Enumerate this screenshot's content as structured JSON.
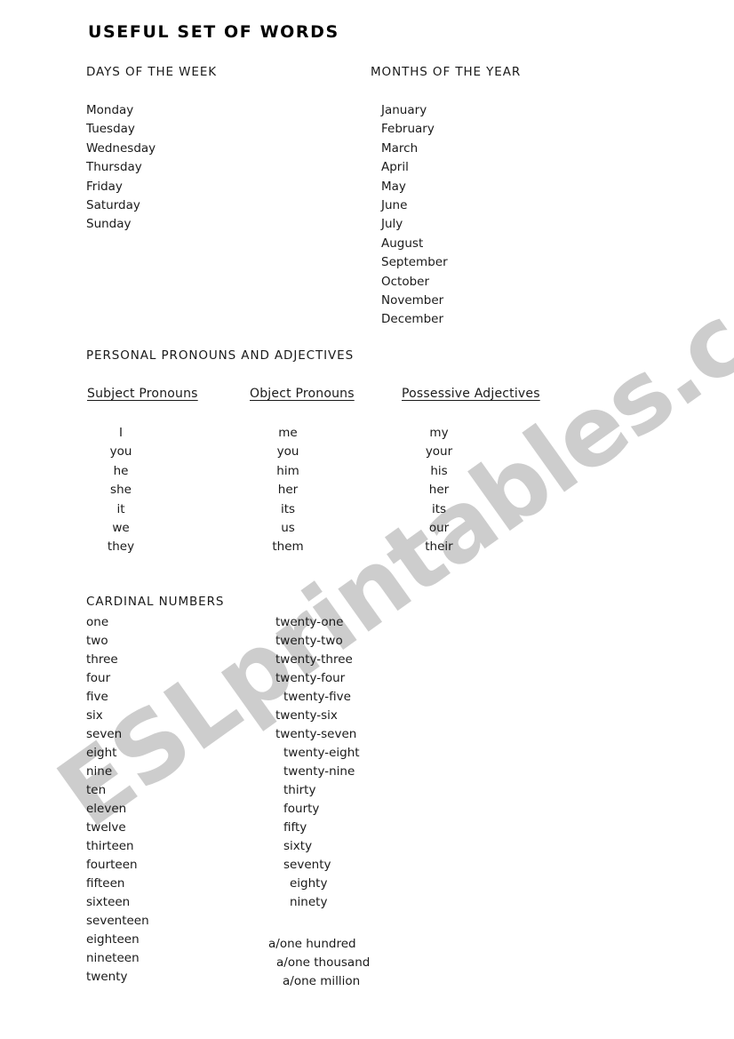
{
  "document": {
    "title": "USEFUL SET OF WORDS"
  },
  "watermark": {
    "text": "ESLprintables.com",
    "color": "#cdcdcd"
  },
  "days_section": {
    "heading": "DAYS OF THE WEEK",
    "items": [
      "Monday",
      "Tuesday",
      "Wednesday",
      "Thursday",
      "Friday",
      "Saturday",
      "Sunday"
    ]
  },
  "months_section": {
    "heading": "MONTHS OF THE YEAR",
    "items": [
      "January",
      "February",
      "March",
      "April",
      "May",
      "June",
      "July",
      "August",
      "September",
      "October",
      "November",
      "December"
    ]
  },
  "pronouns_section": {
    "heading": "PERSONAL PRONOUNS AND ADJECTIVES",
    "columns": [
      {
        "heading": "Subject Pronouns",
        "items": [
          "I",
          "you",
          "he",
          "she",
          "it",
          "we",
          "they"
        ]
      },
      {
        "heading": "Object Pronouns",
        "items": [
          "me",
          "you",
          "him",
          "her",
          "its",
          "us",
          "them"
        ]
      },
      {
        "heading": "Possessive Adjectives",
        "items": [
          "my",
          "your",
          "his",
          "her",
          "its",
          "our",
          "their"
        ]
      }
    ]
  },
  "numbers_section": {
    "heading": "CARDINAL NUMBERS",
    "left_column": [
      "one",
      "two",
      "three",
      "four",
      "five",
      "six",
      "seven",
      "eight",
      "nine",
      "ten",
      "eleven",
      "twelve",
      "thirteen",
      "fourteen",
      "fifteen",
      "sixteen",
      "seventeen",
      "eighteen",
      "nineteen",
      "twenty"
    ],
    "right_column": [
      "twenty-one",
      "twenty-two",
      "twenty-three",
      "twenty-four",
      "twenty-five",
      "twenty-six",
      "twenty-seven",
      "twenty-eight",
      "twenty-nine",
      "thirty",
      "fourty",
      "fifty",
      "sixty",
      "seventy",
      "eighty",
      "ninety"
    ],
    "large_numbers": [
      "a/one  hundred",
      "a/one thousand",
      "a/one million"
    ]
  }
}
